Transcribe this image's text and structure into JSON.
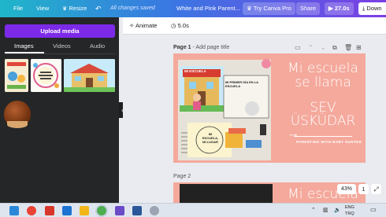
{
  "toolbar": {
    "file_label": "File",
    "view_label": "View",
    "resize_label": "Resize",
    "save_status": "All changes saved",
    "doc_title": "White and Pink Parent...",
    "try_pro_label": "Try Canva Pro",
    "share_label": "Share",
    "timer_label": "27.0s",
    "download_label": "Down"
  },
  "left_panel": {
    "upload_label": "Upload media",
    "tabs": [
      {
        "label": "Images",
        "active": true
      },
      {
        "label": "Videos",
        "active": false
      },
      {
        "label": "Audio",
        "active": false
      }
    ]
  },
  "editor_header": {
    "animate_label": "Animate",
    "duration_label": "5.0s"
  },
  "pages": [
    {
      "label": "Page 1",
      "title_placeholder": "- Add page title",
      "heading_line1": "Mi escuela",
      "heading_line2": "se llama",
      "name_line1": "SEV",
      "name_line2": "ÜSKÜDAR",
      "subtitle": "PARENTING WITH BABY HUNTER",
      "card_sign": "MI ESCUELA",
      "card_primer": "MI PRIMER DÍA EN LA ESCUELA",
      "card_lugar": "MI ESCUELA, MI LUGAR"
    },
    {
      "label": "Page 2",
      "heading_partial": "Mi escuela"
    }
  ],
  "zoom": {
    "level": "43%",
    "page_count": "1"
  },
  "taskbar": {
    "lang": "ENG",
    "region": "TRQ",
    "time": "",
    "date": ""
  },
  "colors": {
    "accent": "#7d2ae8",
    "slide_bg": "#f4a99c"
  }
}
